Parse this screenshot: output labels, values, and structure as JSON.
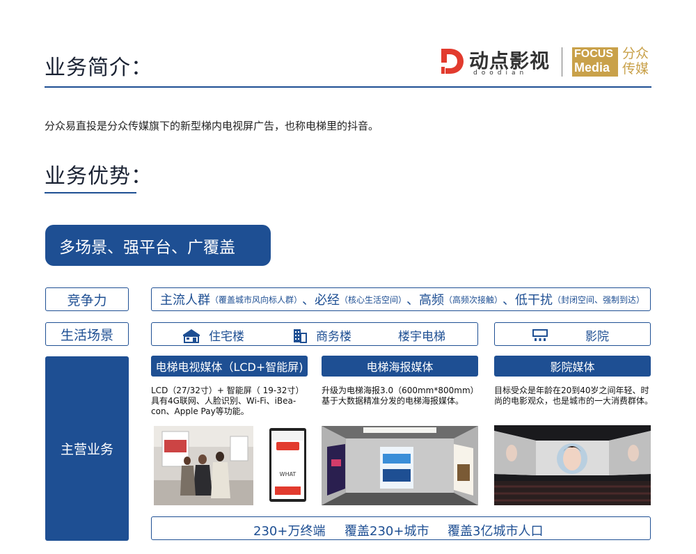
{
  "section1": {
    "title": "业务简介："
  },
  "logos": {
    "dd_main": "动点影视",
    "dd_sub": "doodian",
    "focus_line1": "FOCUS",
    "focus_line2": "Media",
    "focus_cn_line1": "分众",
    "focus_cn_line2": "传媒"
  },
  "intro_text": "分众易直投是分众传媒旗下的新型梯内电视屏广告，也称电梯里的抖音。",
  "section2": {
    "title": "业务优势："
  },
  "highlight": "多场景、强平台、广覆盖",
  "rows": {
    "competitiveness": {
      "label": "竞争力",
      "items": [
        {
          "big": "主流人群",
          "small": "（覆盖城市风向标人群）",
          "sep": "、"
        },
        {
          "big": "必经",
          "small": "（核心生活空间）",
          "sep": "、"
        },
        {
          "big": "高频",
          "small": "（高频次接触）",
          "sep": "、"
        },
        {
          "big": "低干扰",
          "small": "（封闭空间、强制到达）",
          "sep": ""
        }
      ]
    },
    "scenes": {
      "label": "生活场景",
      "items": [
        "住宅楼",
        "商务楼",
        "楼宇电梯",
        "影院"
      ]
    },
    "business": {
      "label": "主营业务",
      "media": [
        {
          "title": "电梯电视媒体（LCD+智能屏)",
          "desc": [
            "LCD（27/32寸）+ 智能屏（ 19-32寸）",
            "具有4G联网、人脸识别、Wi-Fi、iBea-",
            "con、Apple Pay等功能。"
          ]
        },
        {
          "title": "电梯海报媒体",
          "desc": [
            "升级为电梯海报3.0（600mm*800mm）",
            "基于大数据精准分发的电梯海报媒体。"
          ]
        },
        {
          "title": "影院媒体",
          "desc": [
            "目标受众是年龄在20到40岁之间年轻、时",
            "尚的电影观众，也是城市的一大消费群体。"
          ]
        }
      ],
      "screen_text": "WHAT"
    },
    "coverage": [
      "230+万终端",
      "覆盖230+城市",
      "覆盖3亿城市人口"
    ]
  },
  "colors": {
    "brand_blue": "#1e4f93",
    "focus_gold": "#c9a14a",
    "dd_red": "#e23b2e"
  }
}
